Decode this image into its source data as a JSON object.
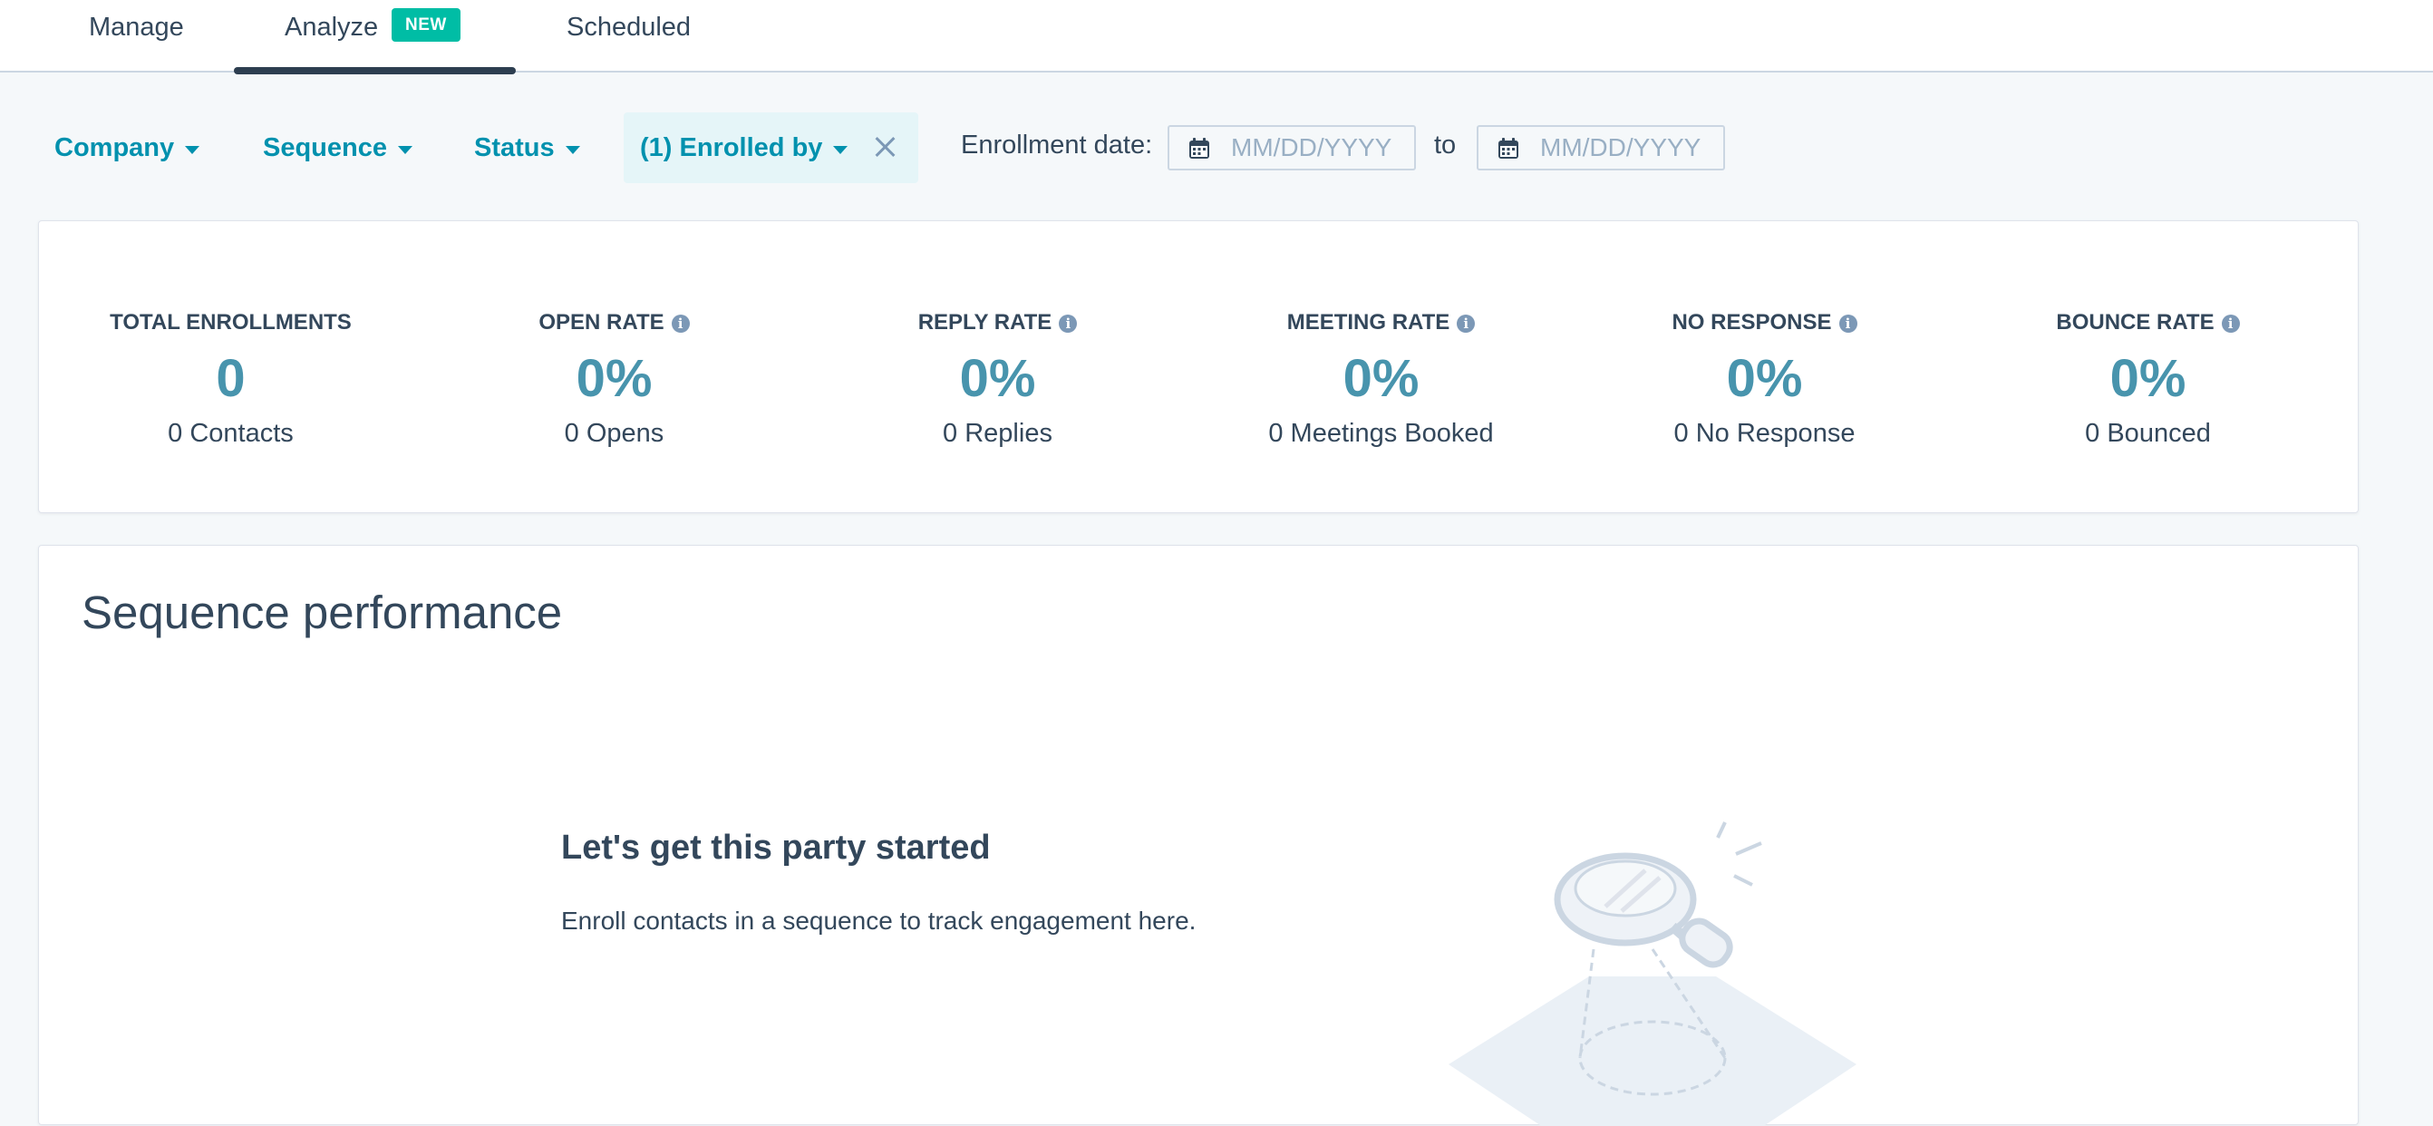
{
  "tabs": [
    {
      "label": "Manage",
      "active": false
    },
    {
      "label": "Analyze",
      "active": true,
      "badge": "NEW"
    },
    {
      "label": "Scheduled",
      "active": false
    }
  ],
  "filters": {
    "company": "Company",
    "sequence": "Sequence",
    "status": "Status",
    "enrolled_by": "(1) Enrolled by",
    "enrollment_date_label": "Enrollment date:",
    "date_from_placeholder": "MM/DD/YYYY",
    "to_label": "to",
    "date_to_placeholder": "MM/DD/YYYY"
  },
  "stats": [
    {
      "title": "TOTAL ENROLLMENTS",
      "info": false,
      "value": "0",
      "sub": "0 Contacts"
    },
    {
      "title": "OPEN RATE",
      "info": true,
      "value": "0%",
      "sub": "0 Opens"
    },
    {
      "title": "REPLY RATE",
      "info": true,
      "value": "0%",
      "sub": "0 Replies"
    },
    {
      "title": "MEETING RATE",
      "info": true,
      "value": "0%",
      "sub": "0 Meetings Booked"
    },
    {
      "title": "NO RESPONSE",
      "info": true,
      "value": "0%",
      "sub": "0 No Response"
    },
    {
      "title": "BOUNCE RATE",
      "info": true,
      "value": "0%",
      "sub": "0 Bounced"
    }
  ],
  "performance": {
    "title": "Sequence performance",
    "empty_title": "Let's get this party started",
    "empty_description": "Enroll contacts in a sequence to track engagement here."
  },
  "icons": {
    "info": "info-icon",
    "calendar": "calendar-icon",
    "caret": "caret-down-icon",
    "close": "close-icon",
    "illustration": "magnifying-glass-illustration"
  },
  "colors": {
    "accent": "#0091ae",
    "stat_value": "#4894ad",
    "badge": "#00bda5",
    "text": "#33475b",
    "background": "#f5f8fa"
  }
}
